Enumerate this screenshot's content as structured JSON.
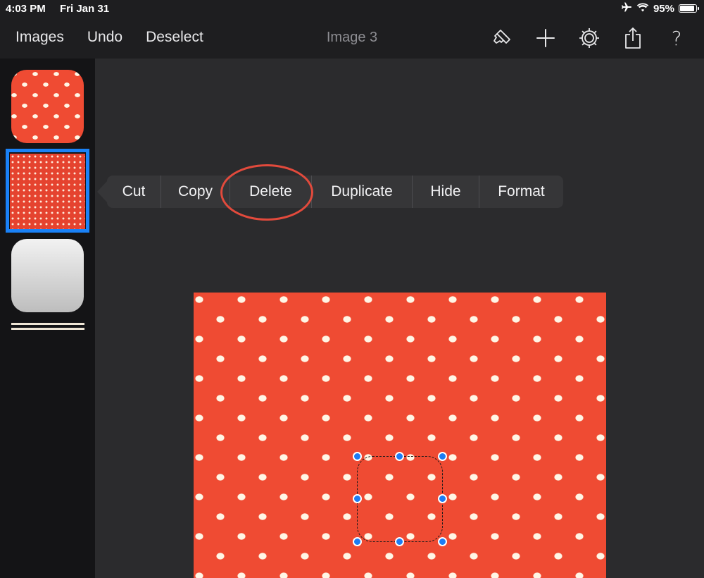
{
  "status": {
    "time": "4:03 PM",
    "date": "Fri Jan 31",
    "battery": "95%",
    "battery_level": 0.95
  },
  "toolbar": {
    "images_label": "Images",
    "undo_label": "Undo",
    "deselect_label": "Deselect",
    "title": "Image 3",
    "icons": [
      "paintbrush-icon",
      "plus-icon",
      "gear-icon",
      "share-icon",
      "help-icon"
    ],
    "help_glyph": "?"
  },
  "context_menu": {
    "items": [
      "Cut",
      "Copy",
      "Delete",
      "Duplicate",
      "Hide",
      "Format"
    ],
    "highlighted": "Delete"
  },
  "colors": {
    "accent": "#1a82f7",
    "pattern_red": "#ef4b33",
    "highlight_ring": "#e24a3c"
  }
}
